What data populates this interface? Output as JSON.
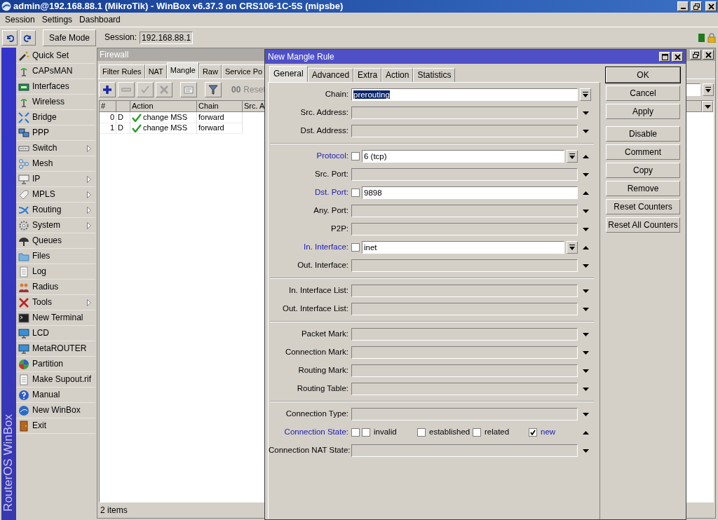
{
  "window": {
    "title": "admin@192.168.88.1 (MikroTik) - WinBox v6.37.3 on CRS106-1C-5S (mipsbe)"
  },
  "menu": [
    "Session",
    "Settings",
    "Dashboard"
  ],
  "toolbar": {
    "safe_mode": "Safe Mode",
    "session_label": "Session:",
    "session_value": "192.168.88.1"
  },
  "brand": "RouterOS WinBox",
  "sidebar": {
    "items": [
      {
        "label": "Quick Set",
        "submenu": false
      },
      {
        "label": "CAPsMAN",
        "submenu": false
      },
      {
        "label": "Interfaces",
        "submenu": false
      },
      {
        "label": "Wireless",
        "submenu": false
      },
      {
        "label": "Bridge",
        "submenu": false
      },
      {
        "label": "PPP",
        "submenu": false
      },
      {
        "label": "Switch",
        "submenu": true
      },
      {
        "label": "Mesh",
        "submenu": false
      },
      {
        "label": "IP",
        "submenu": true
      },
      {
        "label": "MPLS",
        "submenu": true
      },
      {
        "label": "Routing",
        "submenu": true
      },
      {
        "label": "System",
        "submenu": true
      },
      {
        "label": "Queues",
        "submenu": false
      },
      {
        "label": "Files",
        "submenu": false
      },
      {
        "label": "Log",
        "submenu": false
      },
      {
        "label": "Radius",
        "submenu": false
      },
      {
        "label": "Tools",
        "submenu": true
      },
      {
        "label": "New Terminal",
        "submenu": false
      },
      {
        "label": "LCD",
        "submenu": false
      },
      {
        "label": "MetaROUTER",
        "submenu": false
      },
      {
        "label": "Partition",
        "submenu": false
      },
      {
        "label": "Make Supout.rif",
        "submenu": false
      },
      {
        "label": "Manual",
        "submenu": false
      },
      {
        "label": "New WinBox",
        "submenu": false
      },
      {
        "label": "Exit",
        "submenu": false
      }
    ]
  },
  "firewall": {
    "title": "Firewall",
    "tabs": [
      {
        "label": "Filter Rules",
        "selected": false
      },
      {
        "label": "NAT",
        "selected": false
      },
      {
        "label": "Mangle",
        "selected": true
      },
      {
        "label": "Raw",
        "selected": false
      },
      {
        "label": "Service Po",
        "selected": false
      }
    ],
    "reset": {
      "icon_text": "00",
      "label": "Reset"
    },
    "table": {
      "columns": [
        "#",
        "Action",
        "Chain",
        "Src. A"
      ],
      "rows": [
        {
          "number": "0",
          "flag": "D",
          "action": "change MSS",
          "chain": "forward"
        },
        {
          "number": "1",
          "flag": "D",
          "action": "change MSS",
          "chain": "forward"
        }
      ]
    },
    "status": "2 items"
  },
  "dialog": {
    "title": "New Mangle Rule",
    "tabs": [
      {
        "label": "General",
        "selected": true
      },
      {
        "label": "Advanced",
        "selected": false
      },
      {
        "label": "Extra",
        "selected": false
      },
      {
        "label": "Action",
        "selected": false
      },
      {
        "label": "Statistics",
        "selected": false
      }
    ],
    "sections": [
      {
        "rows": [
          {
            "kind": "required",
            "label": "Chain:",
            "value": "prerouting",
            "value_selected": true
          },
          {
            "kind": "matcher",
            "label": "Src. Address:",
            "expanded": false
          },
          {
            "kind": "matcher",
            "label": "Dst. Address:",
            "expanded": false
          }
        ]
      },
      {
        "rows": [
          {
            "kind": "matcher",
            "label": "Protocol:",
            "expanded": true,
            "negated": false,
            "value": "6 (tcp)",
            "list": true
          },
          {
            "kind": "matcher",
            "label": "Src. Port:",
            "expanded": false
          },
          {
            "kind": "matcher",
            "label": "Dst. Port:",
            "expanded": true,
            "negated": false,
            "value": "9898",
            "list": false
          },
          {
            "kind": "matcher",
            "label": "Any. Port:",
            "expanded": false
          },
          {
            "kind": "matcher",
            "label": "P2P:",
            "expanded": false
          },
          {
            "kind": "matcher",
            "label": "In. Interface:",
            "expanded": true,
            "negated": false,
            "value": "inet",
            "list": true
          },
          {
            "kind": "matcher",
            "label": "Out. Interface:",
            "expanded": false
          }
        ]
      },
      {
        "rows": [
          {
            "kind": "matcher",
            "label": "In. Interface List:",
            "expanded": false
          },
          {
            "kind": "matcher",
            "label": "Out. Interface List:",
            "expanded": false
          }
        ]
      },
      {
        "rows": [
          {
            "kind": "matcher",
            "label": "Packet Mark:",
            "expanded": false
          },
          {
            "kind": "matcher",
            "label": "Connection Mark:",
            "expanded": false
          },
          {
            "kind": "matcher",
            "label": "Routing Mark:",
            "expanded": false
          },
          {
            "kind": "matcher",
            "label": "Routing Table:",
            "expanded": false
          }
        ]
      },
      {
        "rows": [
          {
            "kind": "matcher",
            "label": "Connection Type:",
            "expanded": false
          },
          {
            "kind": "flags",
            "label": "Connection State:",
            "expanded": true,
            "negated": false,
            "options": [
              {
                "label": "invalid",
                "checked": false
              },
              {
                "label": "established",
                "checked": false
              },
              {
                "label": "related",
                "checked": false
              },
              {
                "label": "new",
                "checked": true
              }
            ]
          },
          {
            "kind": "matcher",
            "label": "Connection NAT State:",
            "expanded": false
          }
        ]
      }
    ],
    "button_groups": [
      [
        {
          "label": "OK",
          "default": true
        },
        {
          "label": "Cancel",
          "default": false
        },
        {
          "label": "Apply",
          "default": false
        }
      ],
      [
        {
          "label": "Disable",
          "default": false
        },
        {
          "label": "Comment",
          "default": false
        },
        {
          "label": "Copy",
          "default": false
        },
        {
          "label": "Remove",
          "default": false
        },
        {
          "label": "Reset Counters",
          "default": false
        },
        {
          "label": "Reset All Counters",
          "default": false
        }
      ]
    ]
  }
}
